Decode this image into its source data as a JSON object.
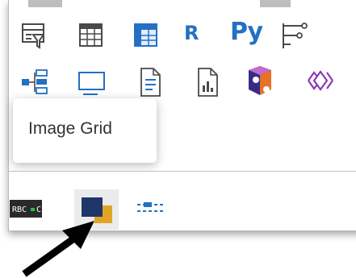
{
  "toolbar": {
    "row1": [
      {
        "name": "slicer-visual",
        "icon": "slicer-filter-icon"
      },
      {
        "name": "table-visual",
        "icon": "table-icon"
      },
      {
        "name": "matrix-visual",
        "icon": "matrix-icon"
      },
      {
        "name": "r-script-visual",
        "label": "R",
        "icon": "r-script-icon"
      },
      {
        "name": "python-visual",
        "label": "Py",
        "icon": "python-icon"
      },
      {
        "name": "key-influencers-visual",
        "icon": "key-influencers-icon"
      }
    ],
    "row2": [
      {
        "name": "decomposition-tree-visual",
        "icon": "decomposition-tree-icon"
      },
      {
        "name": "qa-visual",
        "icon": "qa-icon"
      },
      {
        "name": "smart-narrative-visual",
        "icon": "smart-narrative-icon"
      },
      {
        "name": "paginated-report-visual",
        "icon": "paginated-report-icon"
      },
      {
        "name": "power-apps-visual",
        "icon": "power-apps-icon"
      },
      {
        "name": "power-automate-visual",
        "icon": "power-automate-icon"
      }
    ],
    "row3": [
      {
        "name": "text-filter-visual",
        "icon": "text-filter-icon"
      },
      {
        "name": "image-grid-visual",
        "icon": "image-grid-icon"
      },
      {
        "name": "slider-visual",
        "icon": "slider-icon"
      }
    ]
  },
  "tooltip": {
    "text": "Image Grid"
  },
  "colors": {
    "accent_blue": "#2470c4",
    "navy": "#1f3668",
    "gold": "#e0a526",
    "orange": "#e8712a",
    "purple": "#8d3ab4",
    "tooltip_text": "#333333"
  },
  "annotation": {
    "icon": "arrow-pointer-icon"
  }
}
